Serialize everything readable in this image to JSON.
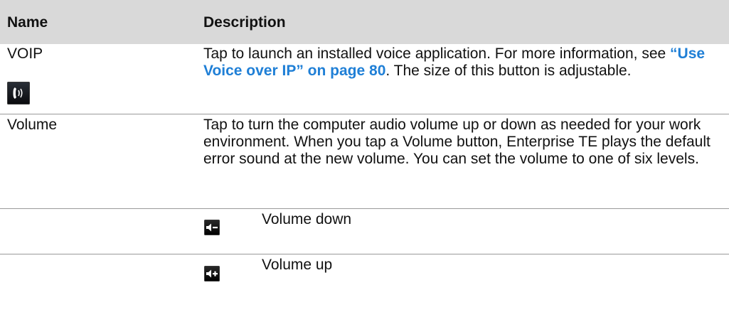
{
  "table": {
    "headers": {
      "name": "Name",
      "description": "Description"
    },
    "rows": [
      {
        "name": "VOIP",
        "description": {
          "before_link": "Tap to launch an installed voice application. For more information, see ",
          "link": "“Use Voice over IP” on page 80",
          "after_link": ". The size of this button is adjustable."
        },
        "icon": "phone-speaker-icon"
      },
      {
        "name": "Volume",
        "description": "Tap to turn the computer audio volume up or down as needed for your work environment. When you tap a Volume button, Enterprise TE plays the default error sound at the new volume. You can set the volume to one of six levels."
      },
      {
        "name": "",
        "icon": "volume-down-icon",
        "label": "Volume down"
      },
      {
        "name": "",
        "icon": "volume-up-icon",
        "label": "Volume up"
      }
    ]
  },
  "colors": {
    "header_background": "#d9d9d9",
    "link": "#1f7fd6",
    "divider": "#9a9a9a"
  }
}
